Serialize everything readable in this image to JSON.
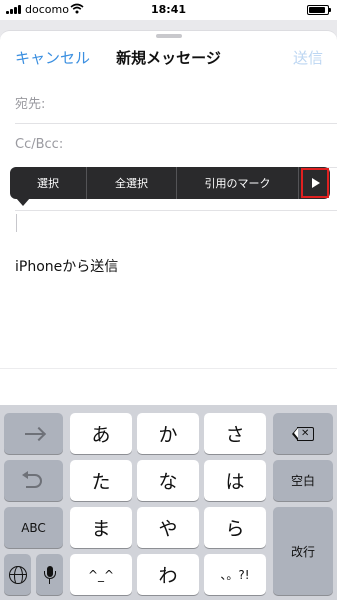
{
  "status_bar": {
    "carrier": "docomo",
    "time": "18:41",
    "battery_level": 0.9,
    "icons": [
      "signal-icon",
      "wifi-icon",
      "battery-icon"
    ]
  },
  "compose": {
    "cancel_label": "キャンセル",
    "title": "新規メッセージ",
    "send_label": "送信",
    "to_label": "宛先:",
    "cc_label": "Cc/Bcc:",
    "body_text": "iPhoneから送信"
  },
  "edit_menu": {
    "items": [
      "選択",
      "全選択",
      "引用のマーク"
    ],
    "more_icon": "play-triangle-icon"
  },
  "keyboard": {
    "row1": [
      "あ",
      "か",
      "さ"
    ],
    "row2": [
      "た",
      "な",
      "は"
    ],
    "row3": [
      "ま",
      "や",
      "ら"
    ],
    "row4": [
      "^_^",
      "わ",
      "、。?!"
    ],
    "space_label": "空白",
    "abc_label": "ABC",
    "return_label": "改行",
    "icons": [
      "arrow-right-icon",
      "undo-icon",
      "delete-icon",
      "globe-icon",
      "microphone-icon"
    ]
  },
  "colors": {
    "accent": "#3b8fe0",
    "send_disabled": "#bcd6f2",
    "highlight_box": "#e02020"
  }
}
